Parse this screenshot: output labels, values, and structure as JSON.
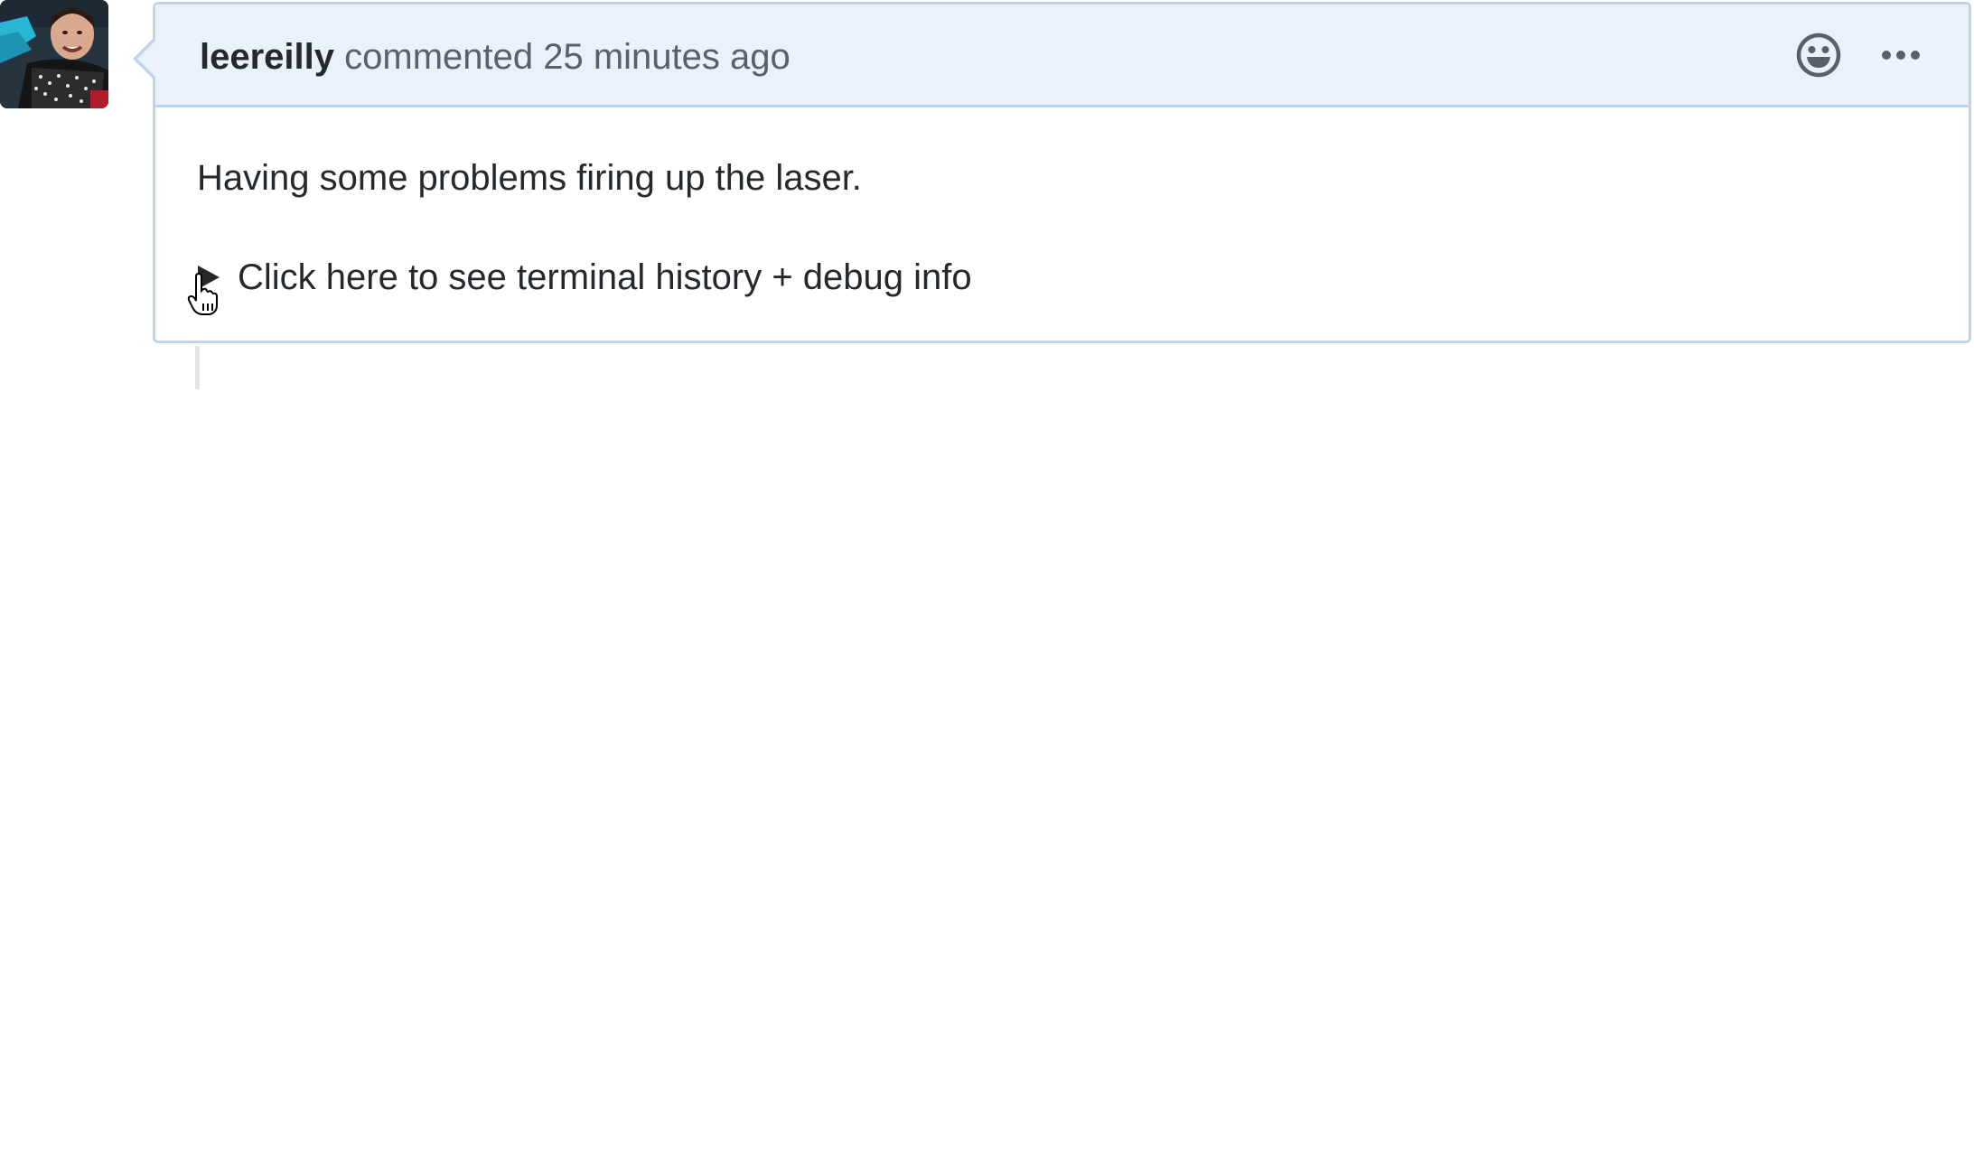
{
  "comment": {
    "author": "leereilly",
    "meta": " commented 25 minutes ago",
    "body": "Having some problems firing up the laser.",
    "details_summary": "Click here to see terminal history + debug info"
  },
  "icons": {
    "reaction": "smiley-icon",
    "more": "kebab-horizontal-icon",
    "disclosure": "triangle-right-icon",
    "cursor": "hand-pointer-icon"
  },
  "colors": {
    "header_bg": "#eaf1fb",
    "border": "#c0d3eb",
    "text": "#24292e",
    "muted": "#586069"
  }
}
